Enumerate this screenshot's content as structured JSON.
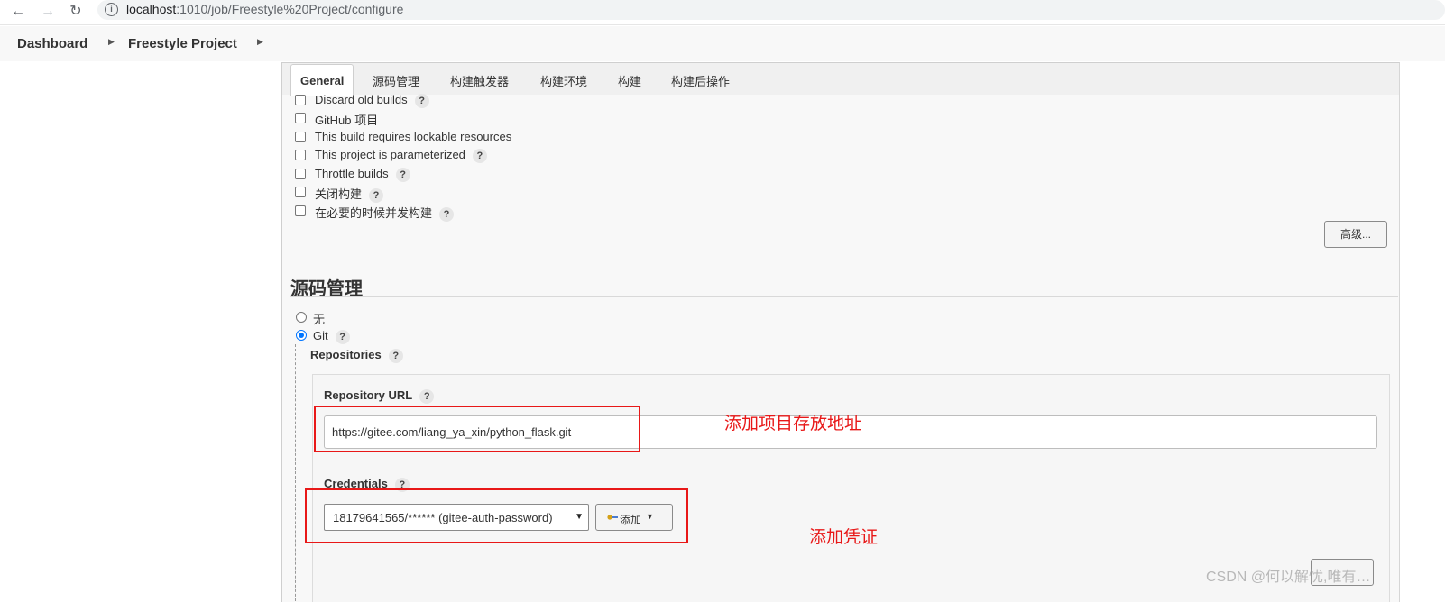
{
  "browser": {
    "back_glyph": "←",
    "forward_glyph": "→",
    "reload_glyph": "↻",
    "info_glyph": "i",
    "url_host": "localhost",
    "url_path": ":1010/job/Freestyle%20Project/configure"
  },
  "breadcrumb": {
    "items": [
      "Dashboard",
      "Freestyle Project"
    ],
    "arrow": "▶"
  },
  "tabs": [
    "General",
    "源码管理",
    "构建触发器",
    "构建环境",
    "构建",
    "构建后操作"
  ],
  "general": {
    "options": [
      {
        "label": "Discard old builds",
        "help": true
      },
      {
        "label": "GitHub 项目",
        "help": false
      },
      {
        "label": "This build requires lockable resources",
        "help": false
      },
      {
        "label": "This project is parameterized",
        "help": true
      },
      {
        "label": "Throttle builds",
        "help": true
      },
      {
        "label": "关闭构建",
        "help": true
      },
      {
        "label": "在必要的时候并发构建",
        "help": true
      }
    ],
    "advanced_button": "高级..."
  },
  "scm": {
    "title": "源码管理",
    "options": [
      {
        "label": "无",
        "selected": false
      },
      {
        "label": "Git",
        "selected": true
      }
    ],
    "repositories_label": "Repositories",
    "repo_url_label": "Repository URL",
    "repo_url_value": "https://gitee.com/liang_ya_xin/python_flask.git",
    "credentials_label": "Credentials",
    "credentials_value": "18179641565/****** (gitee-auth-password)",
    "add_button": "添加",
    "help_glyph": "?"
  },
  "annotations": {
    "url_note": "添加项目存放地址",
    "cred_note": "添加凭证",
    "color": "#e81818"
  },
  "watermark": "CSDN @何以解忧,唯有…"
}
